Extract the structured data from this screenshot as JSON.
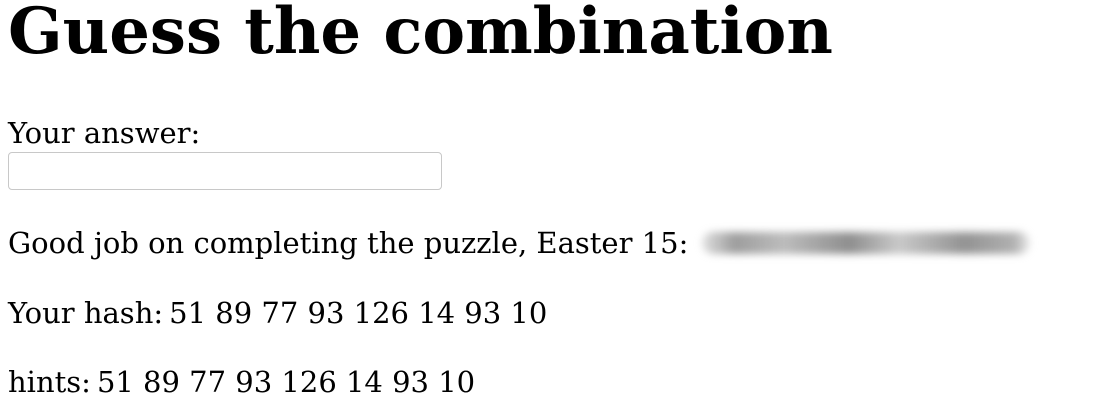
{
  "page": {
    "title": "Guess the combination"
  },
  "form": {
    "answer_label": "Your answer:",
    "answer_value": ""
  },
  "messages": {
    "completion_text": "Good job on completing the puzzle, Easter 15:",
    "hash_label": "Your hash:",
    "hash_value": "51 89 77 93 126 14 93 10",
    "hints_label": "hints:",
    "hints_value": "51 89 77 93 126 14 93 10"
  }
}
